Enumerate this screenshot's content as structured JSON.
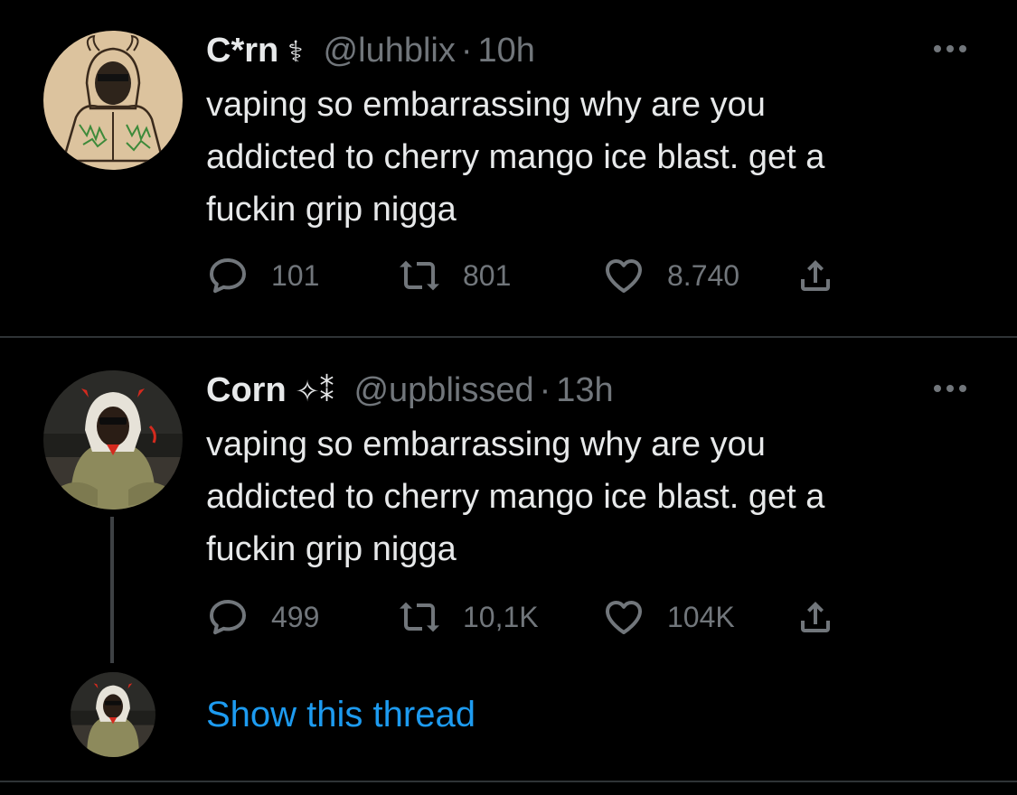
{
  "tweets": [
    {
      "display_name": "C*rn",
      "badge": "⚕",
      "handle": "@luhblix",
      "separator": "·",
      "time": "10h",
      "text": "vaping so embarrassing why are you\naddicted to cherry mango ice blast. get a\nfuckin grip nigga",
      "replies": "101",
      "retweets": "801",
      "likes": "8.740",
      "avatar_icon": "sketch-avatar"
    },
    {
      "display_name": "Corn",
      "badge": "✧⁑",
      "handle": "@upblissed",
      "separator": "·",
      "time": "13h",
      "text": "vaping so embarrassing why are you\naddicted to cherry mango ice blast. get a\nfuckin grip nigga",
      "replies": "499",
      "retweets": "10,1K",
      "likes": "104K",
      "avatar_icon": "photo-avatar"
    }
  ],
  "thread": {
    "show_label": "Show this thread"
  },
  "icons": {
    "reply": "reply-icon",
    "retweet": "retweet-icon",
    "like": "heart-icon",
    "share": "share-icon",
    "more": "more-icon"
  },
  "colors": {
    "background": "#000000",
    "text": "#e7e9ea",
    "secondary": "#71767b",
    "link": "#1d9bf0",
    "divider": "#2f3336"
  }
}
